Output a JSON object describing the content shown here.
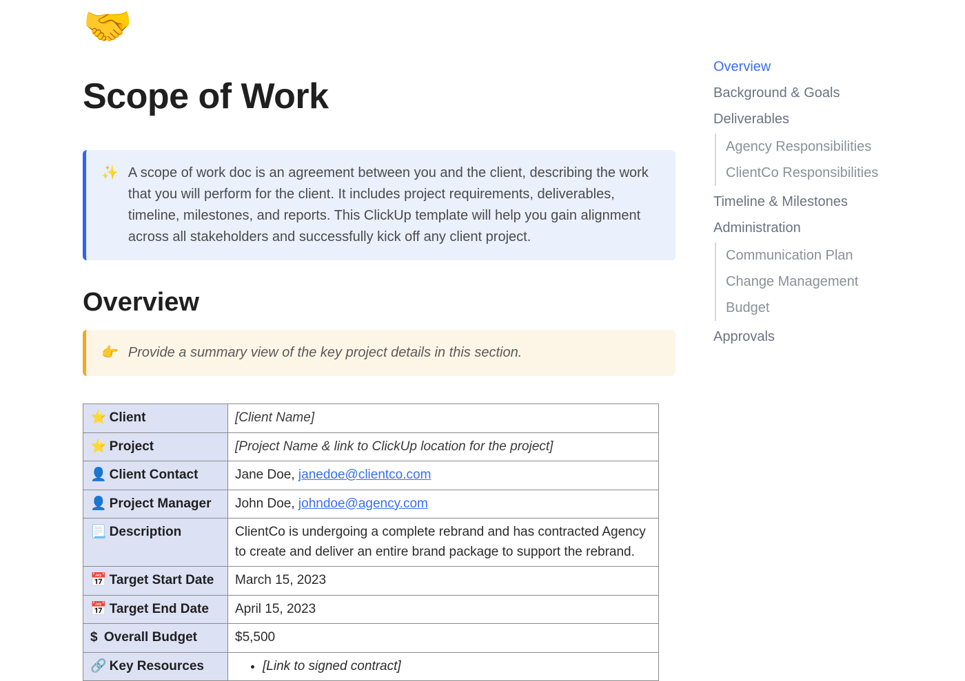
{
  "page_icon": "🤝",
  "title": "Scope of Work",
  "intro_callout": {
    "icon": "✨",
    "text": "A scope of work doc is an agreement between you and the client, describing the work that you will perform for the client. It includes project requirements, deliverables, timeline, milestones, and reports. This ClickUp template will help you gain alignment across all stakeholders and successfully kick off any client project."
  },
  "overview": {
    "heading": "Overview",
    "callout": {
      "icon": "👉",
      "text": "Provide a summary view of the key project details in this section."
    },
    "rows": {
      "client": {
        "icon": "⭐",
        "label": "Client",
        "value": "[Client Name]"
      },
      "project": {
        "icon": "⭐",
        "label": "Project",
        "value": "[Project Name & link to ClickUp location for the project]"
      },
      "client_contact": {
        "icon": "👤",
        "label": "Client Contact",
        "prefix": "Jane Doe, ",
        "email": "janedoe@clientco.com"
      },
      "project_manager": {
        "icon": "👤",
        "label": "Project Manager",
        "prefix": "John Doe, ",
        "email": "johndoe@agency.com"
      },
      "description": {
        "icon": "📃",
        "label": "Description",
        "value": "ClientCo is undergoing a complete rebrand and has contracted Agency to create and deliver an entire brand package to support the rebrand."
      },
      "target_start": {
        "icon": "📅",
        "label": "Target Start Date",
        "value": "March 15, 2023"
      },
      "target_end": {
        "icon": "📅",
        "label": "Target End Date",
        "value": "April 15, 2023"
      },
      "budget": {
        "icon": "$",
        "label": "Overall Budget",
        "value": "$5,500"
      },
      "resources": {
        "icon": "🔗",
        "label": "Key Resources",
        "item": "[Link to signed contract]"
      }
    }
  },
  "toc": {
    "items": [
      {
        "label": "Overview",
        "active": true
      },
      {
        "label": "Background & Goals"
      },
      {
        "label": "Deliverables",
        "children": [
          "Agency Responsibilities",
          "ClientCo Responsibilities"
        ]
      },
      {
        "label": "Timeline & Milestones"
      },
      {
        "label": "Administration",
        "children": [
          "Communication Plan",
          "Change Management",
          "Budget"
        ]
      },
      {
        "label": "Approvals"
      }
    ]
  }
}
